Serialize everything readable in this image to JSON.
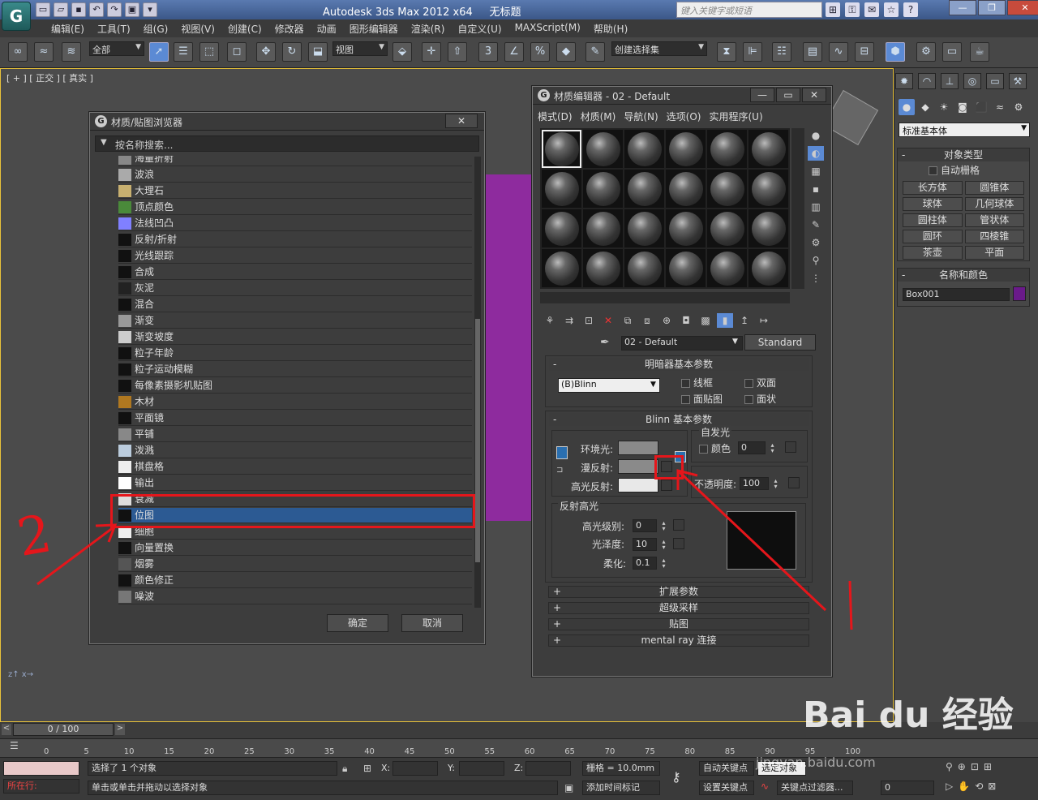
{
  "app": {
    "title": "Autodesk 3ds Max  2012 x64",
    "doc": "无标题",
    "search_placeholder": "键入关键字或短语"
  },
  "menu": [
    "编辑(E)",
    "工具(T)",
    "组(G)",
    "视图(V)",
    "创建(C)",
    "修改器",
    "动画",
    "图形编辑器",
    "渲染(R)",
    "自定义(U)",
    "MAXScript(M)",
    "帮助(H)"
  ],
  "toolbar": {
    "filter": "全部",
    "refcoord": "视图",
    "selset": "创建选择集"
  },
  "viewport": {
    "label": "[ + ] [ 正交 ] [ 真实 ]"
  },
  "browser": {
    "title": "材质/贴图浏览器",
    "search": "按名称搜索...",
    "items": [
      {
        "label": "海量折射",
        "color": "#888"
      },
      {
        "label": "波浪",
        "color": "#aaa"
      },
      {
        "label": "大理石",
        "color": "#c8b070"
      },
      {
        "label": "顶点颜色",
        "color": "#4a8a3a"
      },
      {
        "label": "法线凹凸",
        "color": "#8080ff"
      },
      {
        "label": "反射/折射",
        "color": "#111"
      },
      {
        "label": "光线跟踪",
        "color": "#111"
      },
      {
        "label": "合成",
        "color": "#111"
      },
      {
        "label": "灰泥",
        "color": "#222"
      },
      {
        "label": "混合",
        "color": "#111"
      },
      {
        "label": "渐变",
        "color": "#999"
      },
      {
        "label": "渐变坡度",
        "color": "#ccc"
      },
      {
        "label": "粒子年龄",
        "color": "#111"
      },
      {
        "label": "粒子运动模糊",
        "color": "#111"
      },
      {
        "label": "每像素摄影机贴图",
        "color": "#111"
      },
      {
        "label": "木材",
        "color": "#b07820"
      },
      {
        "label": "平面镜",
        "color": "#111"
      },
      {
        "label": "平铺",
        "color": "#888"
      },
      {
        "label": "泼溅",
        "color": "#bcd"
      },
      {
        "label": "棋盘格",
        "color": "#eee"
      },
      {
        "label": "输出",
        "color": "#fff"
      },
      {
        "label": "衰减",
        "color": "#ddd"
      },
      {
        "label": "位图",
        "color": "#111"
      },
      {
        "label": "细胞",
        "color": "#eee"
      },
      {
        "label": "向量置换",
        "color": "#111"
      },
      {
        "label": "烟雾",
        "color": "#555"
      },
      {
        "label": "颜色修正",
        "color": "#111"
      },
      {
        "label": "噪波",
        "color": "#777"
      }
    ],
    "ok": "确定",
    "cancel": "取消"
  },
  "mateditor": {
    "title": "材质编辑器 - 02 - Default",
    "menu": [
      "模式(D)",
      "材质(M)",
      "导航(N)",
      "选项(O)",
      "实用程序(U)"
    ],
    "matname": "02 - Default",
    "mattype": "Standard",
    "shader_rollout": "明暗器基本参数",
    "shader": "(B)Blinn",
    "wire": "线框",
    "twosided": "双面",
    "facemap": "面贴图",
    "faceted": "面状",
    "blinn_rollout": "Blinn 基本参数",
    "selfillum": "自发光",
    "color": "颜色",
    "selfillum_val": "0",
    "ambient": "环境光:",
    "diffuse": "漫反射:",
    "specular": "高光反射:",
    "opacity": "不透明度:",
    "opacity_val": "100",
    "spec_group": "反射高光",
    "spec_level": "高光级别:",
    "spec_level_val": "0",
    "gloss": "光泽度:",
    "gloss_val": "10",
    "soften": "柔化:",
    "soften_val": "0.1",
    "rollouts": [
      "扩展参数",
      "超级采样",
      "贴图",
      "mental ray 连接"
    ]
  },
  "rightpanel": {
    "category": "标准基本体",
    "objtype": "对象类型",
    "autogrid": "自动栅格",
    "buttons": [
      "长方体",
      "圆锥体",
      "球体",
      "几何球体",
      "圆柱体",
      "管状体",
      "圆环",
      "四棱锥",
      "茶壶",
      "平面"
    ],
    "namecolor": "名称和颜色",
    "objname": "Box001",
    "objcolor": "#6a1a8a"
  },
  "timeline": {
    "frame": "0 / 100",
    "ticks": [
      "0",
      "5",
      "10",
      "15",
      "20",
      "25",
      "30",
      "35",
      "40",
      "45",
      "50",
      "55",
      "60",
      "65",
      "70",
      "75",
      "80",
      "85",
      "90",
      "95",
      "100"
    ]
  },
  "status": {
    "selected": "选择了 1 个对象",
    "prompt": "单击或单击并拖动以选择对象",
    "running": "所在行:",
    "x": "X:",
    "y": "Y:",
    "z": "Z:",
    "grid": "栅格 = 10.0mm",
    "addtime": "添加时间标记",
    "autokey": "自动关键点",
    "setkey": "设置关键点",
    "selobj": "选定对象",
    "keyfilter": "关键点过滤器...",
    "frameval": "0"
  },
  "annotations": {
    "one": "1",
    "two": "2"
  },
  "watermark": {
    "brand": "Bai du 经验",
    "url": "jingyan.baidu.com"
  }
}
